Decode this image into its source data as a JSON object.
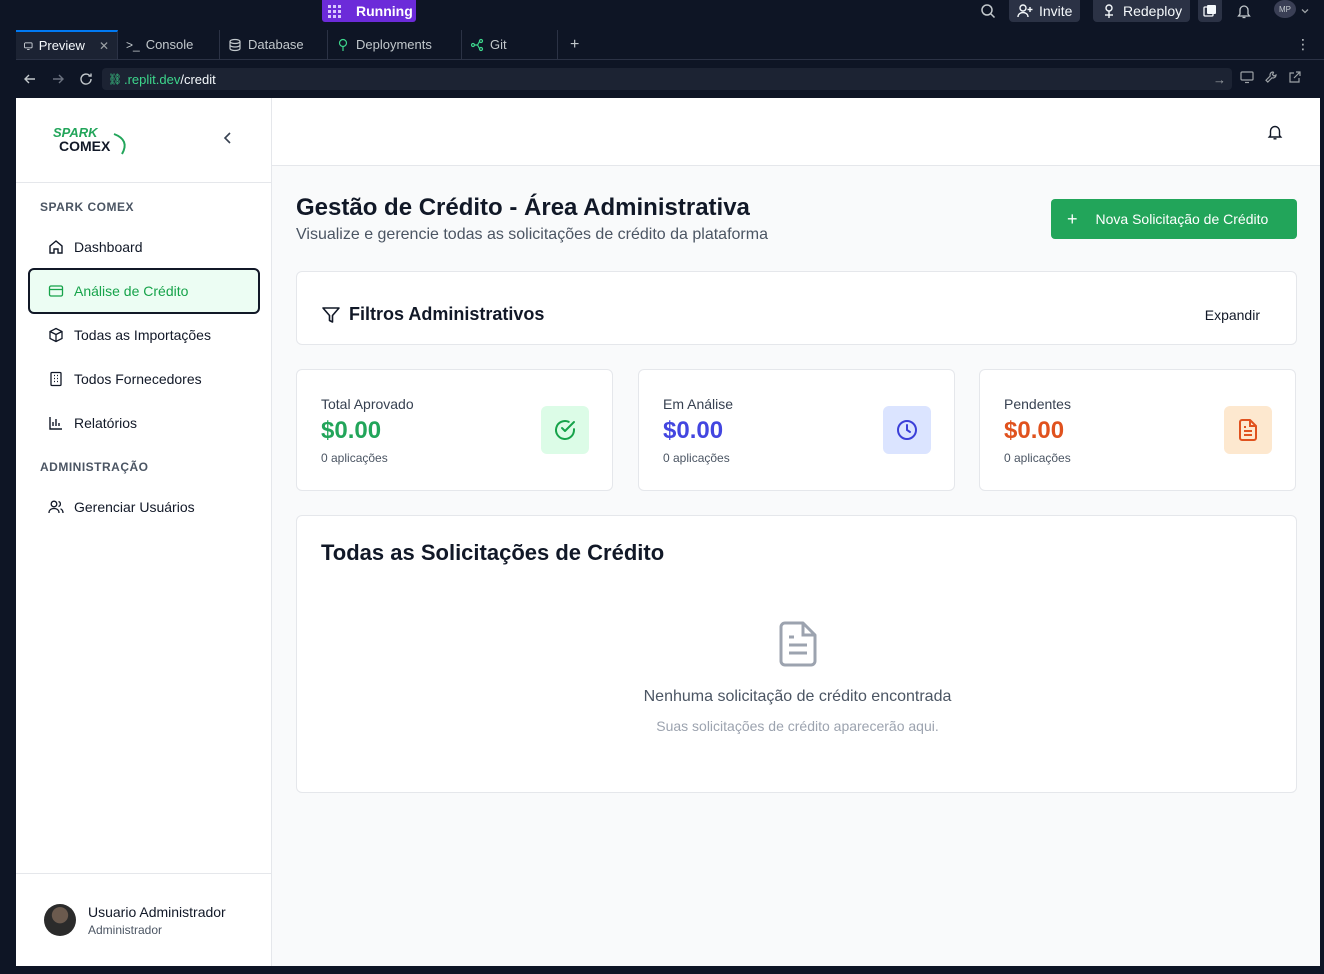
{
  "topbar": {
    "run_status": "Running",
    "invite_label": "Invite",
    "redeploy_label": "Redeploy",
    "avatar_initials": "MP"
  },
  "tabs": [
    {
      "label": "Preview",
      "icon": "monitor-icon"
    },
    {
      "label": "Console",
      "icon": "terminal-icon"
    },
    {
      "label": "Database",
      "icon": "database-icon"
    },
    {
      "label": "Deployments",
      "icon": "deployments-icon"
    },
    {
      "label": "Git",
      "icon": "git-icon"
    }
  ],
  "url": {
    "host": ".replit.dev",
    "path": "/credit"
  },
  "colors": {
    "accent_green": "#22a55a",
    "blue": "#4346e0",
    "orange": "#e0521e",
    "replit_purple": "#6c2bd9"
  },
  "sidebar": {
    "logo_top": "SPARK",
    "logo_bottom": "COMEX",
    "section_main": "SPARK COMEX",
    "items": [
      {
        "label": "Dashboard",
        "icon": "home-icon"
      },
      {
        "label": "Análise de Crédito",
        "icon": "credit-card-icon"
      },
      {
        "label": "Todas as Importações",
        "icon": "package-icon"
      },
      {
        "label": "Todos Fornecedores",
        "icon": "building-icon"
      },
      {
        "label": "Relatórios",
        "icon": "bar-chart-icon"
      }
    ],
    "section_admin": "ADMINISTRAÇÃO",
    "admin_items": [
      {
        "label": "Gerenciar Usuários",
        "icon": "users-icon"
      }
    ],
    "user": {
      "name": "Usuario Administrador",
      "role": "Administrador"
    }
  },
  "page": {
    "title": "Gestão de Crédito - Área Administrativa",
    "subtitle": "Visualize e gerencie todas as solicitações de crédito da plataforma",
    "new_button": "Nova Solicitação de Crédito"
  },
  "filters": {
    "title": "Filtros Administrativos",
    "expand_label": "Expandir"
  },
  "stats": [
    {
      "label": "Total Aprovado",
      "value": "$0.00",
      "count": "0 aplicações",
      "icon": "check-circle-icon"
    },
    {
      "label": "Em Análise",
      "value": "$0.00",
      "count": "0 aplicações",
      "icon": "clock-icon"
    },
    {
      "label": "Pendentes",
      "value": "$0.00",
      "count": "0 aplicações",
      "icon": "file-text-icon"
    }
  ],
  "requests": {
    "title": "Todas as Solicitações de Crédito",
    "empty_title": "Nenhuma solicitação de crédito encontrada",
    "empty_subtitle": "Suas solicitações de crédito aparecerão aqui."
  }
}
